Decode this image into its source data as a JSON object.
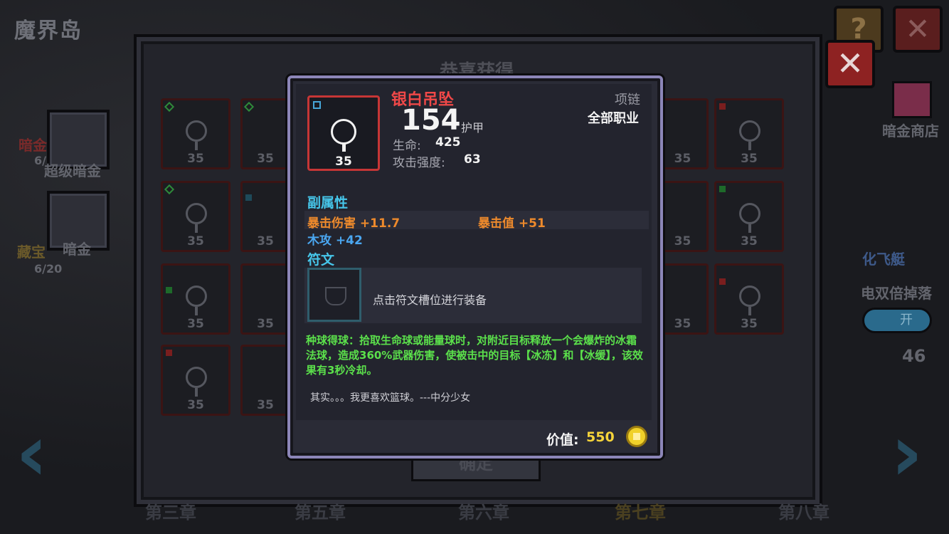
{
  "background": {
    "title": "魔界岛",
    "left_side": {
      "super_dark_gold_label": "超级暗金",
      "dark_gold_label": "暗金",
      "dark_gold_partial": "暗金",
      "count_1": "6/",
      "treasure_label": "藏宝",
      "count_2": "6/20"
    },
    "right_side": {
      "shop_label": "暗金商店",
      "airship_label": "化飞艇",
      "double_drop_label": "电双倍掉落",
      "toggle_label": "开",
      "count": "46"
    },
    "panel": {
      "title": "恭喜获得",
      "confirm_label": "确定",
      "slot_level": "35"
    },
    "bottom_tabs": [
      "第三章",
      "第五章",
      "第六章",
      "第七章",
      "第八章"
    ]
  },
  "tooltip": {
    "item_name": "银白吊坠",
    "item_level": "35",
    "armor_value": "154",
    "armor_label": "护甲",
    "slot_type": "项链",
    "class_requirement": "全部职业",
    "base_stats": [
      {
        "label": "生命:",
        "value": "425"
      },
      {
        "label": "攻击强度:",
        "value": "63"
      }
    ],
    "secondary_header": "副属性",
    "secondary_stats": [
      {
        "text": "暴击伤害 +11.7",
        "color": "#ee8a2c"
      },
      {
        "text": "暴击值 +51",
        "color": "#ee8a2c"
      },
      {
        "text": "木攻 +42",
        "color": "#4aa6f0"
      }
    ],
    "rune_header": "符文",
    "rune_hint": "点击符文槽位进行装备",
    "effect_text": "种球得球：拾取生命球或能量球时，对附近目标释放一个会爆炸的冰霜法球，造成360%武器伤害，使被击中的目标【冰冻】和【冰缓】，该效果有3秒冷却。",
    "flavor_text": "其实。。。我更喜欢篮球。---中分少女",
    "value_label": "价值:",
    "value_amount": "550"
  },
  "colors": {
    "item_name": "#f04848",
    "section_header": "#46c6ea",
    "effect": "#5be04b",
    "gold": "#f6d43a",
    "card_border": "#8c86b8"
  }
}
